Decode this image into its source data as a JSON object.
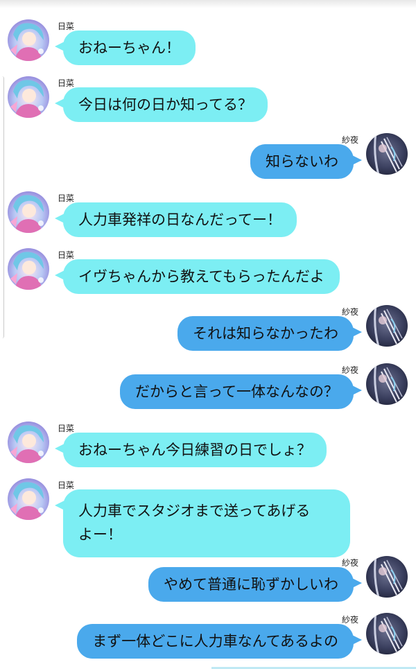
{
  "conversation": {
    "participants": {
      "hina": "日菜",
      "sayo": "紗夜"
    },
    "messages": [
      {
        "sender": "日菜",
        "side": "left",
        "text": "おねーちゃん！"
      },
      {
        "sender": "日菜",
        "side": "left",
        "text": "今日は何の日か知ってる？"
      },
      {
        "sender": "紗夜",
        "side": "right",
        "text": "知らないわ"
      },
      {
        "sender": "日菜",
        "side": "left",
        "text": "人力車発祥の日なんだってー！"
      },
      {
        "sender": "日菜",
        "side": "left",
        "text": "イヴちゃんから教えてもらったんだよ"
      },
      {
        "sender": "紗夜",
        "side": "right",
        "text": "それは知らなかったわ"
      },
      {
        "sender": "紗夜",
        "side": "right",
        "text": "だからと言って一体なんなの？"
      },
      {
        "sender": "日菜",
        "side": "left",
        "text": "おねーちゃん今日練習の日でしょ？"
      },
      {
        "sender": "日菜",
        "side": "left",
        "text": "人力車でスタジオまで送ってあげる\nよー！"
      },
      {
        "sender": "紗夜",
        "side": "right",
        "text": "やめて普通に恥ずかしいわ"
      },
      {
        "sender": "紗夜",
        "side": "right",
        "text": "まず一体どこに人力車なんてあるよの"
      }
    ]
  },
  "colors": {
    "left_bubble": "#7ceef3",
    "right_bubble": "#4aa9ec",
    "text": "#111111",
    "background": "#ffffff"
  },
  "icons": {
    "hina_avatar": "avatar-hina-icon",
    "sayo_avatar": "avatar-sayo-icon"
  }
}
